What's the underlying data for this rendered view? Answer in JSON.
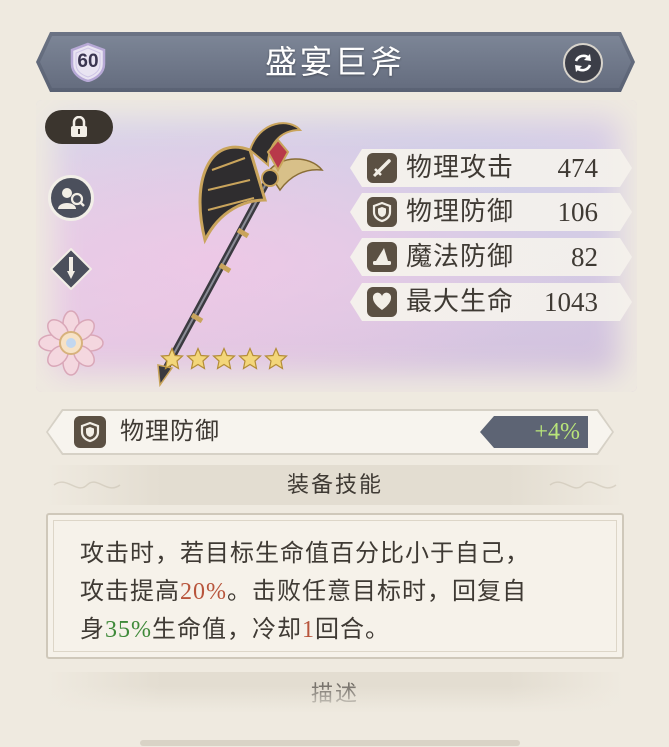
{
  "header": {
    "level": "60",
    "title": "盛宴巨斧"
  },
  "side_buttons": [
    "lock-icon",
    "search-user-icon",
    "skill-icon",
    "flower-icon"
  ],
  "stats": [
    {
      "icon": "sword-icon",
      "label": "物理攻击",
      "value": "474"
    },
    {
      "icon": "shield-icon",
      "label": "物理防御",
      "value": "106"
    },
    {
      "icon": "wizard-hat-icon",
      "label": "魔法防御",
      "value": "82"
    },
    {
      "icon": "heart-icon",
      "label": "最大生命",
      "value": "1043"
    }
  ],
  "rarity_stars": 5,
  "sub_stat": {
    "icon": "shield-icon",
    "label": "物理防御",
    "value": "+4%"
  },
  "skill_section": {
    "title": "装备技能",
    "line1": "攻击时，若目标生命值百分比小于自己，",
    "line2_a": "攻击提高",
    "line2_b": "20%",
    "line2_c": "。击败任意目标时，回复自",
    "line3_a": "身",
    "line3_b": "35%",
    "line3_c": "生命值，冷却",
    "line3_d": "1",
    "line3_e": "回合。"
  },
  "description_section": {
    "title": "描述"
  },
  "colors": {
    "header": "#6b7384",
    "stat_icon_bg": "#5b5043",
    "highlight_red": "#b8553c",
    "highlight_green": "#3f8a3a",
    "bonus_value": "#b9e57a"
  }
}
